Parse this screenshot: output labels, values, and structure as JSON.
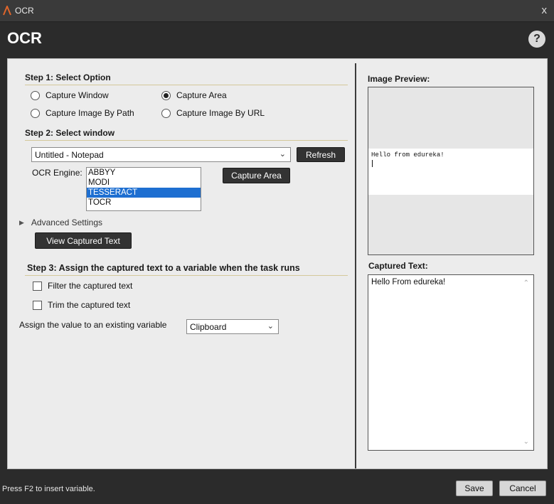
{
  "window": {
    "title": "OCR",
    "close_glyph": "x"
  },
  "header": {
    "title": "OCR",
    "help_glyph": "?"
  },
  "step1": {
    "title": "Step 1: Select Option",
    "options": [
      {
        "label": "Capture Window",
        "selected": false
      },
      {
        "label": "Capture Area",
        "selected": true
      },
      {
        "label": "Capture Image By Path",
        "selected": false
      },
      {
        "label": "Capture Image By URL",
        "selected": false
      }
    ]
  },
  "step2": {
    "title": "Step 2: Select window",
    "window_select": {
      "value": "Untitled - Notepad"
    },
    "refresh_label": "Refresh",
    "ocr_engine_label": "OCR Engine:",
    "engines": [
      "ABBYY",
      "MODI",
      "TESSERACT",
      "TOCR"
    ],
    "selected_engine": "TESSERACT",
    "capture_area_label": "Capture Area",
    "advanced_label": "Advanced Settings",
    "view_captured_label": "View Captured Text"
  },
  "step3": {
    "title": "Step 3: Assign the captured text to a variable when the task runs",
    "filter_label": "Filter the captured text",
    "trim_label": "Trim the captured text",
    "assign_label": "Assign the value to an existing variable",
    "variable_value": "Clipboard"
  },
  "preview": {
    "title": "Image Preview:",
    "image_text": "Hello from edureka!"
  },
  "captured": {
    "title": "Captured Text:",
    "text": "Hello From edureka!"
  },
  "footer": {
    "hint": "Press F2 to insert variable.",
    "save_label": "Save",
    "cancel_label": "Cancel"
  },
  "colors": {
    "accent": "#1e6fd1",
    "dark": "#2b2b2b",
    "panel": "#ececec"
  },
  "icons": {
    "app": "app-logo-icon",
    "help": "help-icon",
    "close": "close-icon",
    "chevron": "chevron-down-icon"
  }
}
